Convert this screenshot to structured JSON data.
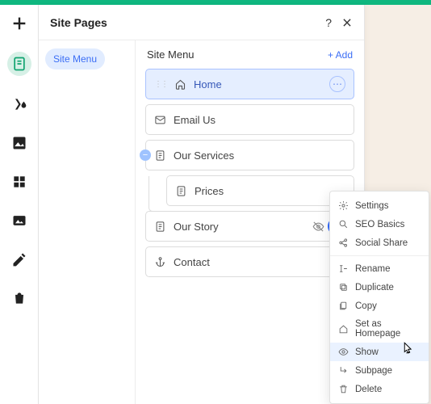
{
  "panel": {
    "title": "Site Pages"
  },
  "sidebar": {
    "pill_label": "Site Menu"
  },
  "main": {
    "heading": "Site Menu",
    "add_label": "+ Add",
    "items": [
      {
        "label": "Home"
      },
      {
        "label": "Email Us"
      },
      {
        "label": "Our Services"
      },
      {
        "label": "Prices"
      },
      {
        "label": "Our Story"
      },
      {
        "label": "Contact"
      }
    ]
  },
  "context_menu": {
    "items": {
      "settings": "Settings",
      "seo": "SEO Basics",
      "social": "Social Share",
      "rename": "Rename",
      "duplicate": "Duplicate",
      "copy": "Copy",
      "homepage": "Set as Homepage",
      "show": "Show",
      "subpage": "Subpage",
      "delete": "Delete"
    }
  }
}
